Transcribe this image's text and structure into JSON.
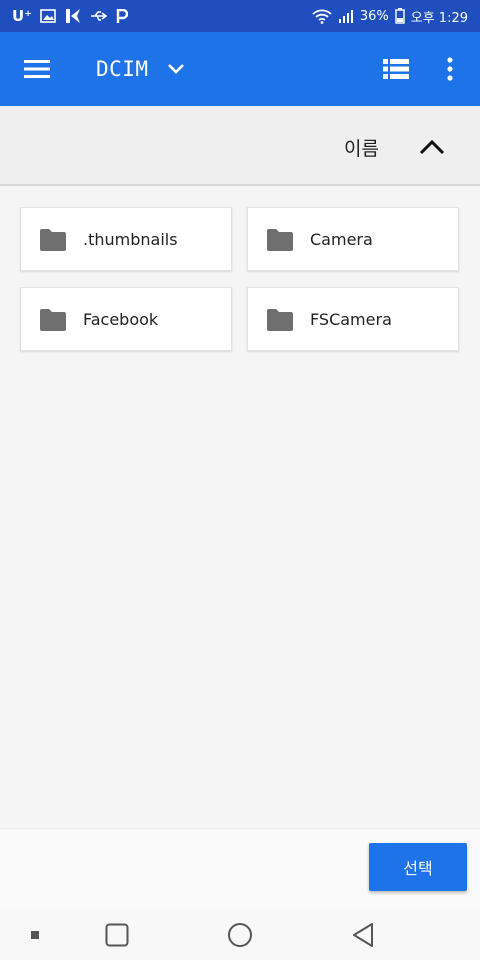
{
  "status_bar": {
    "carrier": "U⁺",
    "battery": "36%",
    "time": "오후 1:29"
  },
  "app_bar": {
    "title": "DCIM"
  },
  "sort": {
    "label": "이름"
  },
  "folders": [
    {
      "name": ".thumbnails"
    },
    {
      "name": "Camera"
    },
    {
      "name": "Facebook"
    },
    {
      "name": "FSCamera"
    }
  ],
  "actions": {
    "select_label": "선택"
  },
  "icons": {
    "menu": "hamburger-menu-icon",
    "dropdown": "chevron-down-icon",
    "view": "list-view-icon",
    "more": "more-vert-icon",
    "sort": "chevron-up-icon",
    "folder": "folder-icon"
  },
  "colors": {
    "status_bar": "#1f4fbf",
    "app_bar": "#1e73e8",
    "button": "#1e73e8",
    "folder_icon": "#6f6f6f"
  }
}
